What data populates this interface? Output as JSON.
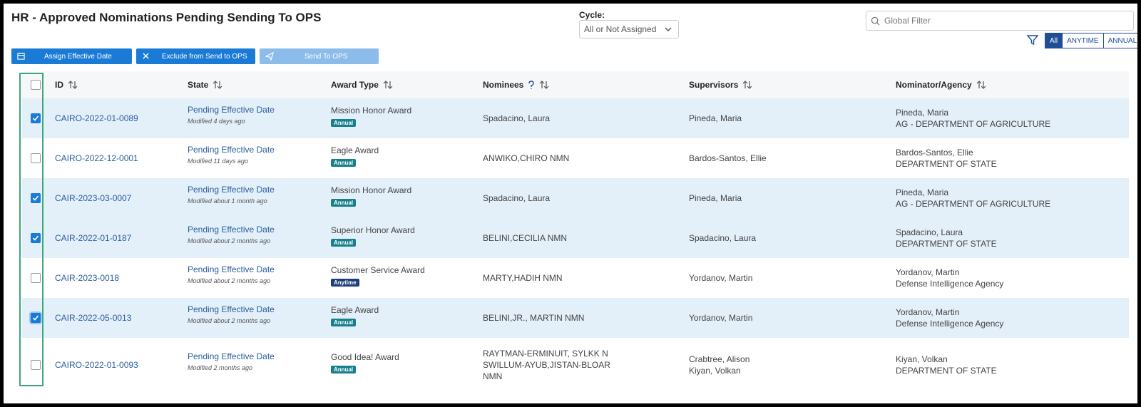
{
  "page": {
    "title": "HR - Approved Nominations Pending Sending To OPS"
  },
  "cycle": {
    "label": "Cycle:",
    "value": "All or Not Assigned"
  },
  "global_filter": {
    "placeholder": "Global Filter"
  },
  "filter_tabs": [
    "All",
    "ANYTIME",
    "ANNUAL"
  ],
  "toolbar": {
    "assign_label": "Assign Effective Date",
    "exclude_label": "Exclude from Send to OPS",
    "send_label": "Send To OPS"
  },
  "columns": {
    "id": "ID",
    "state": "State",
    "award": "Award Type",
    "nominees": "Nominees",
    "supervisors": "Supervisors",
    "agency": "Nominator/Agency"
  },
  "rows": [
    {
      "checked": true,
      "id": "CAIRO-2022-01-0089",
      "state": "Pending Effective Date",
      "modified": "Modified 4 days ago",
      "award": "Mission Honor Award",
      "badge": "Annual",
      "nominees": [
        "Spadacino, Laura"
      ],
      "supervisors": [
        "Pineda, Maria"
      ],
      "nominator": "Pineda, Maria",
      "agency": "AG - DEPARTMENT OF AGRICULTURE"
    },
    {
      "checked": false,
      "id": "CAIRO-2022-12-0001",
      "state": "Pending Effective Date",
      "modified": "Modified 11 days ago",
      "award": "Eagle Award",
      "badge": "Annual",
      "nominees": [
        "ANWIKO,CHIRO NMN"
      ],
      "supervisors": [
        "Bardos-Santos, Ellie"
      ],
      "nominator": "Bardos-Santos, Ellie",
      "agency": "DEPARTMENT OF STATE"
    },
    {
      "checked": true,
      "id": "CAIR-2023-03-0007",
      "state": "Pending Effective Date",
      "modified": "Modified about 1 month ago",
      "award": "Mission Honor Award",
      "badge": "Annual",
      "nominees": [
        "Spadacino, Laura"
      ],
      "supervisors": [
        "Pineda, Maria"
      ],
      "nominator": "Pineda, Maria",
      "agency": "AG - DEPARTMENT OF AGRICULTURE"
    },
    {
      "checked": true,
      "id": "CAIR-2022-01-0187",
      "state": "Pending Effective Date",
      "modified": "Modified about 2 months ago",
      "award": "Superior Honor Award",
      "badge": "Annual",
      "nominees": [
        "BELINI,CECILIA NMN"
      ],
      "supervisors": [
        "Spadacino, Laura"
      ],
      "nominator": "Spadacino, Laura",
      "agency": "DEPARTMENT OF STATE"
    },
    {
      "checked": false,
      "id": "CAIR-2023-0018",
      "state": "Pending Effective Date",
      "modified": "Modified about 2 months ago",
      "award": "Customer Service Award",
      "badge": "Anytime",
      "nominees": [
        "MARTY,HADIH NMN"
      ],
      "supervisors": [
        "Yordanov, Martin"
      ],
      "nominator": "Yordanov, Martin",
      "agency": "Defense Intelligence Agency"
    },
    {
      "checked": true,
      "id": "CAIR-2022-05-0013",
      "state": "Pending Effective Date",
      "modified": "Modified about 2 months ago",
      "award": "Eagle Award",
      "badge": "Annual",
      "nominees": [
        "BELINI,JR., MARTIN NMN"
      ],
      "supervisors": [
        "Yordanov, Martin"
      ],
      "nominator": "Yordanov, Martin",
      "agency": "Defense Intelligence Agency"
    },
    {
      "checked": false,
      "id": "CAIRO-2022-01-0093",
      "state": "Pending Effective Date",
      "modified": "Modified 2 months ago",
      "award": "Good Idea! Award",
      "badge": "Annual",
      "nominees": [
        "RAYTMAN-ERMINUIT, SYLKK N",
        "SWILLUM-AYUB,JISTAN-BLOAR",
        "NMN"
      ],
      "supervisors": [
        "Crabtree, Alison",
        "Kiyan, Volkan"
      ],
      "nominator": "Kiyan, Volkan",
      "agency": "DEPARTMENT OF STATE"
    }
  ],
  "colors": {
    "primary": "#1a7bd6",
    "selected_row": "#e3eff9",
    "annual_badge": "#18808c",
    "anytime_badge": "#1f3f7a",
    "highlight_box": "#3ca77a"
  }
}
